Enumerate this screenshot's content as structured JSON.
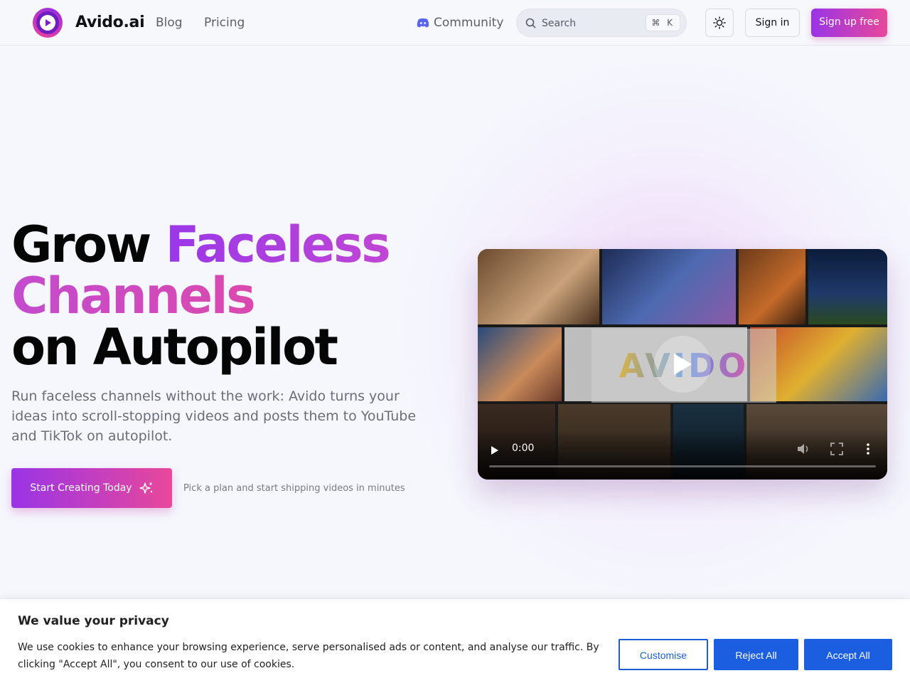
{
  "nav": {
    "brand": "Avido.ai",
    "links": [
      "Blog",
      "Pricing"
    ],
    "community": "Community",
    "search_placeholder": "Search",
    "search_shortcut": "⌘ K",
    "sign_in": "Sign in",
    "sign_up": "Sign up free"
  },
  "hero": {
    "line1_plain": "Grow ",
    "line1_accent": "Faceless",
    "line2_accent": "Channels",
    "line3": "on Autopilot",
    "subtitle": "Run faceless channels without the work: Avido turns your ideas into scroll-stopping videos and posts them to YouTube and TikTok on autopilot.",
    "cta": "Start Creating Today",
    "cta_note": "Pick a plan and start shipping videos in minutes"
  },
  "video": {
    "watermark": "AVIDO",
    "time": "0:00",
    "progress": 0
  },
  "cookie": {
    "title": "We value your privacy",
    "text": "We use cookies to enhance your browsing experience, serve personalised ads or content, and analyse our traffic. By clicking \"Accept All\", you consent to our use of cookies.",
    "customise": "Customise",
    "reject": "Reject All",
    "accept": "Accept All"
  },
  "colors": {
    "accent_purple": "#9a34e6",
    "accent_pink": "#e8489a",
    "cookie_blue": "#1b5fe0"
  }
}
